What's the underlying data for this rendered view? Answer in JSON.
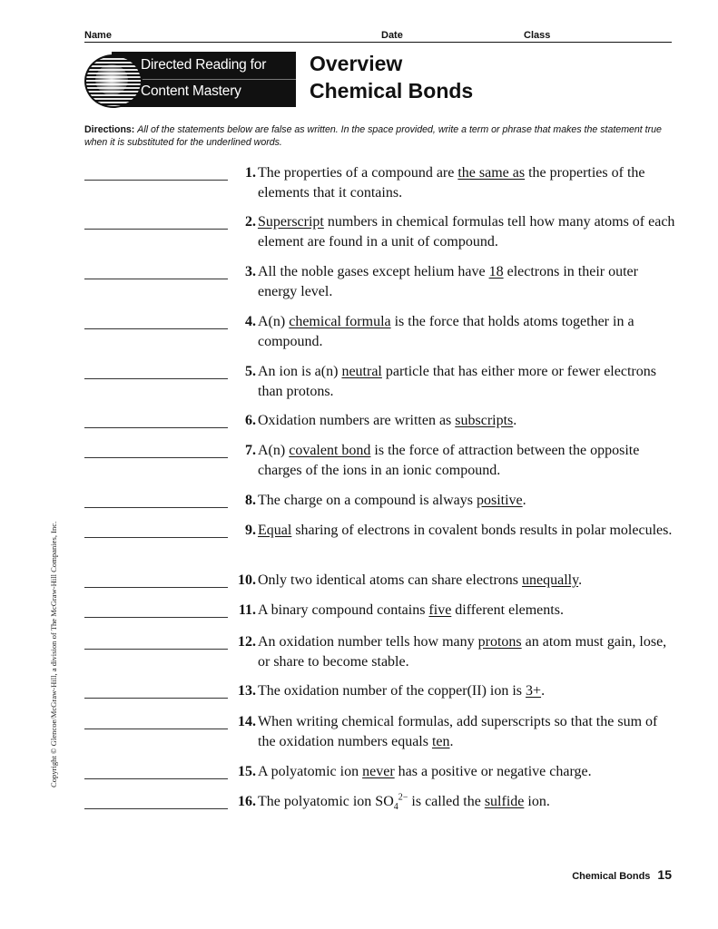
{
  "header": {
    "name_label": "Name",
    "date_label": "Date",
    "class_label": "Class"
  },
  "banner": {
    "line1": "Directed Reading for",
    "line2": "Content Mastery"
  },
  "title": {
    "line1": "Overview",
    "line2": "Chemical Bonds"
  },
  "directions": {
    "label": "Directions:",
    "text": "All of the statements below are false as written. In the space provided, write a term or phrase that makes the statement true when it is substituted for the underlined words."
  },
  "questions": [
    {
      "num": "1.",
      "before": "The properties of a compound are ",
      "underlined": "the same as",
      "after": " the properties of the elements that it contains."
    },
    {
      "num": "2.",
      "before": "",
      "underlined": "Superscript",
      "after": " numbers in chemical formulas tell how many atoms of each element are found in a unit of compound."
    },
    {
      "num": "3.",
      "before": "All the noble gases except helium have ",
      "underlined": "18",
      "after": " electrons in their outer energy level."
    },
    {
      "num": "4.",
      "before": "A(n) ",
      "underlined": "chemical formula",
      "after": " is the force that holds atoms together in a compound."
    },
    {
      "num": "5.",
      "before": "An ion is a(n) ",
      "underlined": "neutral",
      "after": " particle that has either more or fewer electrons than protons."
    },
    {
      "num": "6.",
      "before": "Oxidation numbers are written as ",
      "underlined": "subscripts",
      "after": "."
    },
    {
      "num": "7.",
      "before": "A(n) ",
      "underlined": "covalent bond",
      "after": " is the force of attraction between the opposite charges of the ions in an ionic compound."
    },
    {
      "num": "8.",
      "before": "The charge on a compound is always ",
      "underlined": "positive",
      "after": "."
    },
    {
      "num": "9.",
      "before": "",
      "underlined": "Equal",
      "after": " sharing of electrons in covalent bonds results in polar molecules."
    },
    {
      "num": "10.",
      "before": "Only two identical atoms can share electrons ",
      "underlined": "unequally",
      "after": "."
    },
    {
      "num": "11.",
      "before": "A binary compound contains ",
      "underlined": "five",
      "after": " different elements."
    },
    {
      "num": "12.",
      "before": "An oxidation number tells how many ",
      "underlined": "protons",
      "after": " an atom must gain, lose, or share to become stable."
    },
    {
      "num": "13.",
      "before": "The oxidation number of the copper(II) ion is ",
      "underlined": "3+",
      "after": "."
    },
    {
      "num": "14.",
      "before": "When writing chemical formulas, add superscripts so that the sum of the oxidation numbers equals ",
      "underlined": "ten",
      "after": "."
    },
    {
      "num": "15.",
      "before": "A polyatomic ion ",
      "underlined": "never",
      "after": " has a positive or negative charge."
    },
    {
      "num": "16.",
      "before": "The polyatomic ion SO",
      "sub": "4",
      "sup": "2−",
      "before2": " is called the ",
      "underlined": "sulfide",
      "after": " ion."
    }
  ],
  "copyright": "Copyright © Glencoe/McGraw-Hill, a division of The McGraw-Hill Companies, Inc.",
  "footer": {
    "title": "Chemical Bonds",
    "page": "15"
  }
}
